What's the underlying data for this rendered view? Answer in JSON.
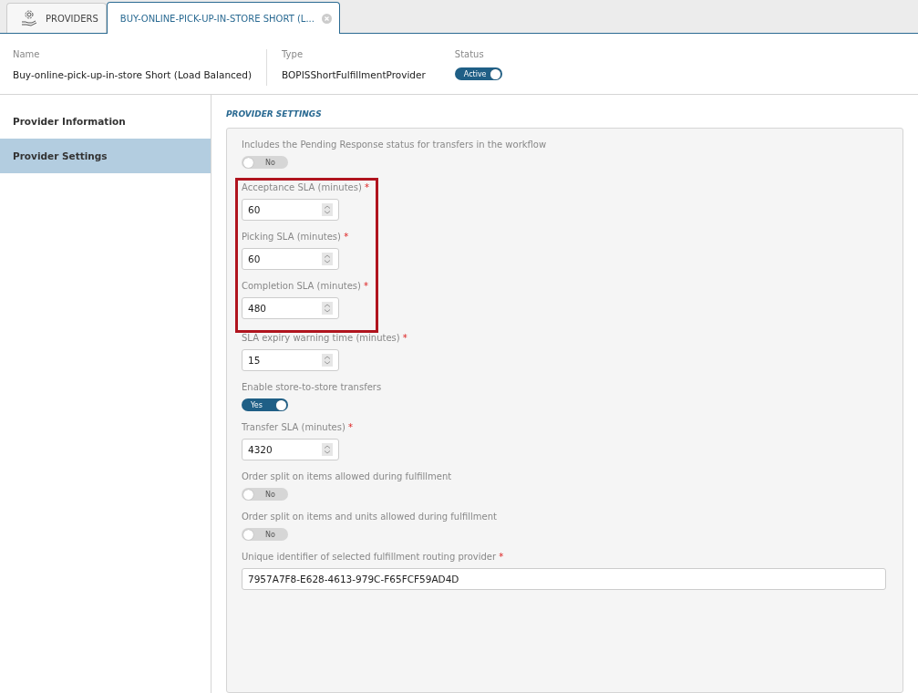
{
  "tabs": [
    {
      "label": "PROVIDERS",
      "selected": false,
      "kind": "home"
    },
    {
      "label": "BUY-ONLINE-PICK-UP-IN-STORE SHORT (L...",
      "selected": true,
      "kind": "closable"
    }
  ],
  "header": {
    "fields": [
      {
        "label": "Name",
        "value": "Buy-online-pick-up-in-store Short (Load Balanced)"
      },
      {
        "label": "Type",
        "value": "BOPISShortFulfillmentProvider"
      }
    ],
    "status": {
      "label": "Status",
      "toggle_text": "Active",
      "on": true
    }
  },
  "sidebar": {
    "items": [
      {
        "label": "Provider Information",
        "selected": false
      },
      {
        "label": "Provider Settings",
        "selected": true
      }
    ]
  },
  "section_title": "PROVIDER SETTINGS",
  "settings": [
    {
      "kind": "toggle",
      "label": "Includes the Pending Response status for transfers in the workflow",
      "toggle_text": "No",
      "on": false
    },
    {
      "kind": "highlight",
      "items": [
        {
          "kind": "number",
          "label": "Acceptance SLA (minutes)",
          "required_mark": "*",
          "value": "60"
        },
        {
          "kind": "number",
          "label": "Picking SLA (minutes)",
          "required_mark": "*",
          "value": "60"
        },
        {
          "kind": "number",
          "label": "Completion SLA (minutes)",
          "required_mark": "*",
          "value": "480"
        }
      ]
    },
    {
      "kind": "number",
      "label": "SLA expiry warning time (minutes)",
      "required_mark": "*",
      "value": "15"
    },
    {
      "kind": "toggle",
      "label": "Enable store-to-store transfers",
      "toggle_text": "Yes",
      "on": true
    },
    {
      "kind": "number",
      "label": "Transfer SLA (minutes)",
      "required_mark": "*",
      "value": "4320"
    },
    {
      "kind": "toggle",
      "label": "Order split on items allowed during fulfillment",
      "toggle_text": "No",
      "on": false
    },
    {
      "kind": "toggle",
      "label": "Order split on items and units allowed during fulfillment",
      "toggle_text": "No",
      "on": false
    },
    {
      "kind": "text",
      "label": "Unique identifier of selected fulfillment routing provider",
      "required_mark": "*",
      "value": "7957A7F8-E628-4613-979C-F65FCF59AD4D"
    }
  ]
}
